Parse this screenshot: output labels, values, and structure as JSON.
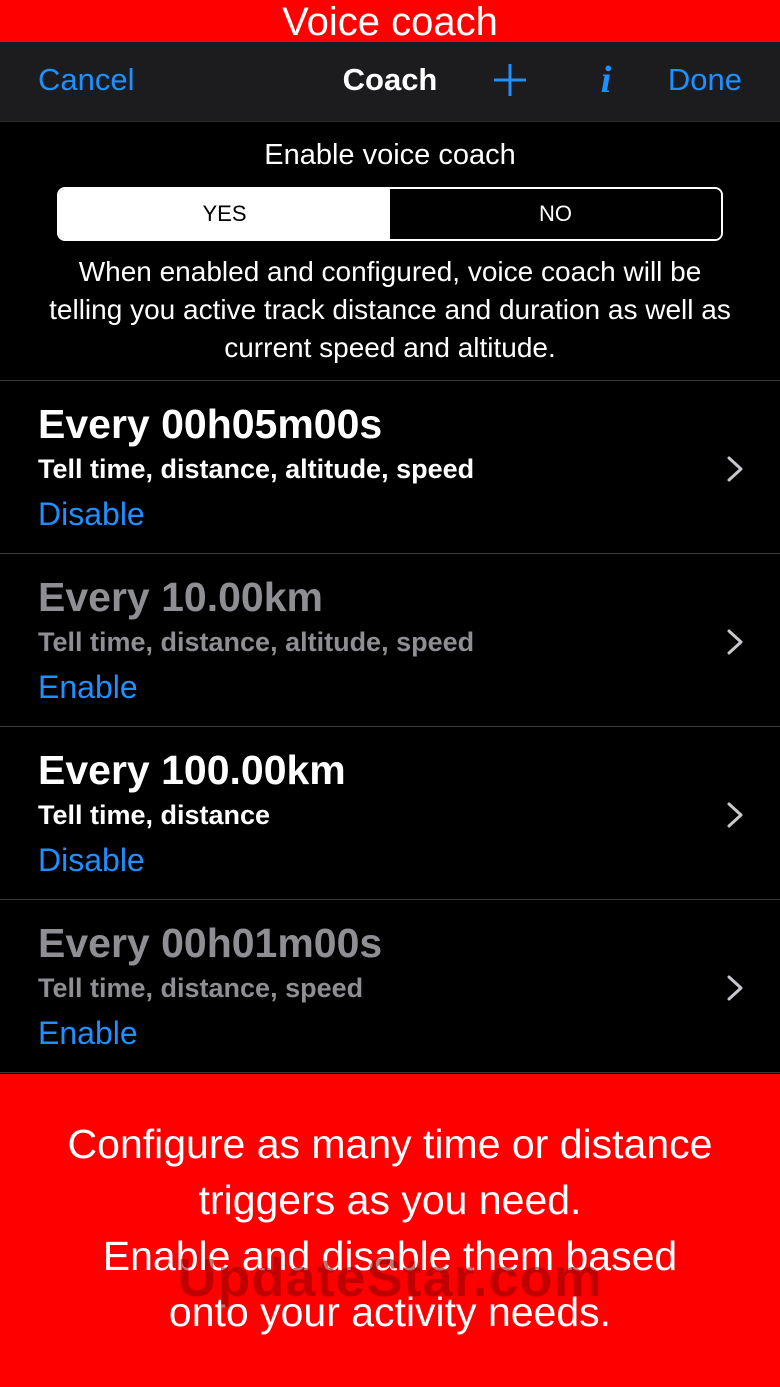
{
  "banner_top": {
    "title": "Voice coach"
  },
  "navbar": {
    "cancel_label": "Cancel",
    "title": "Coach",
    "add_icon": "plus-icon",
    "info_label": "i",
    "done_label": "Done",
    "accent_color": "#1e90ff"
  },
  "enable_section": {
    "label": "Enable voice coach",
    "yes_label": "YES",
    "no_label": "NO",
    "selected": "YES",
    "description": "When enabled and configured, voice coach will be telling you active track distance and duration as well as current speed and altitude."
  },
  "triggers": [
    {
      "title": "Every 00h05m00s",
      "subtitle": "Tell time, distance, altitude, speed",
      "action": "Disable"
    },
    {
      "title": "Every 10.00km",
      "subtitle": "Tell time, distance, altitude, speed",
      "action": "Enable"
    },
    {
      "title": "Every 100.00km",
      "subtitle": "Tell time, distance",
      "action": "Disable"
    },
    {
      "title": "Every 00h01m00s",
      "subtitle": "Tell time, distance, speed",
      "action": "Enable"
    }
  ],
  "banner_bottom": {
    "line1": "Configure as many time or distance",
    "line2": "triggers as you need.",
    "line3": "Enable and disable them based",
    "line4": "onto your activity needs.",
    "background_color": "#ff0000"
  },
  "watermark": "UpdateStar.com"
}
